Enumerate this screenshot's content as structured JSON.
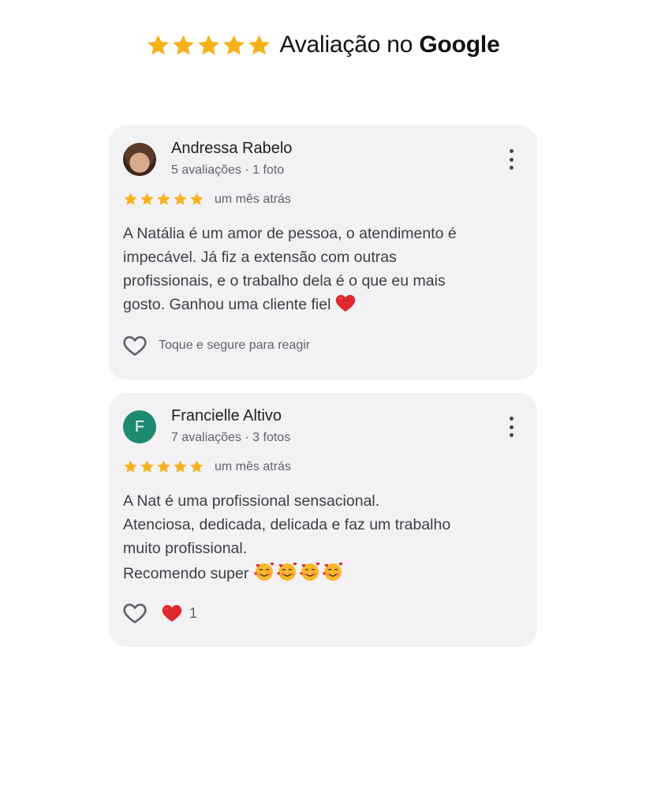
{
  "header": {
    "rating_label": "Avaliação no",
    "brand": "Google",
    "star_count": 5,
    "star_color": "#f6b21b"
  },
  "reviews": [
    {
      "author": "Andressa Rabelo",
      "meta": "5 avaliações · 1 foto",
      "avatar_type": "photo",
      "rating": 5,
      "time": "um mês atrás",
      "text": "A Natália é um amor de pessoa, o atendimento é impecável. Já fiz a extensão com outras profissionais, e o trabalho dela é o que eu mais gosto. Ganhou uma cliente fiel",
      "text_lines": [
        "A Natália é um amor de pessoa, o atendimento é",
        "impecável. Já fiz a extensão com outras",
        "profissionais, e o trabalho dela é o que eu mais",
        "gosto. Ganhou uma cliente fiel"
      ],
      "trailing_emoji": "red-heart-emoji",
      "react_hint": "Toque e segure para reagir"
    },
    {
      "author": "Francielle Altivo",
      "meta": "7 avaliações · 3 fotos",
      "avatar_type": "letter",
      "avatar_letter": "F",
      "avatar_color": "#1e8a72",
      "rating": 5,
      "time": "um mês atrás",
      "text_lines": [
        "A Nat é uma profissional sensacional.",
        "Atenciosa, dedicada, delicada e faz um trabalho",
        "muito profissional.",
        "Recomendo super"
      ],
      "trailing_emoji": "smiling-face-with-hearts-emoji x4",
      "reaction_count": "1"
    }
  ],
  "colors": {
    "card_bg": "#f2f2f4",
    "star": "#f6b21b",
    "secondary_text": "#5f6368"
  }
}
